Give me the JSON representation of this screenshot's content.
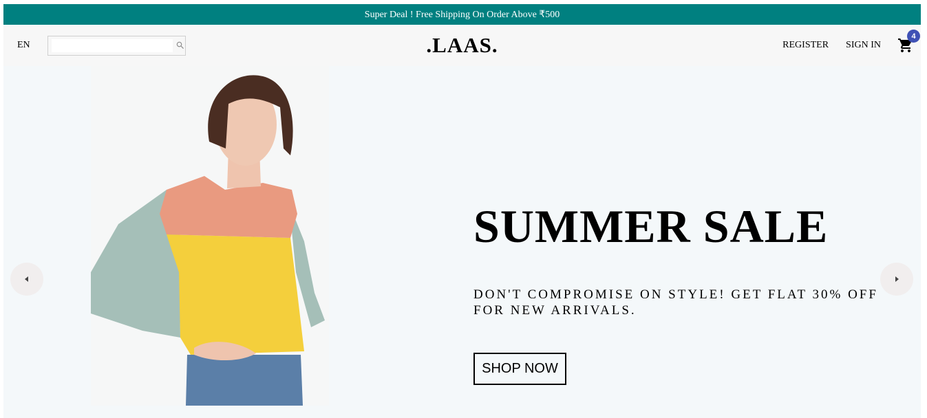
{
  "announcement": {
    "text": "Super Deal ! Free Shipping On Order Above ₹500",
    "bg_color": "#008080"
  },
  "navbar": {
    "language": "EN",
    "search": {
      "value": "",
      "placeholder": ""
    },
    "logo": ".LAAS.",
    "register_label": "REGISTER",
    "sign_in_label": "SIGN IN",
    "cart": {
      "count": "4",
      "badge_color": "#3f51b5"
    }
  },
  "slider": {
    "title": "SUMMER SALE",
    "description": "DON'T COMPROMISE ON STYLE! GET FLAT 30% OFF FOR NEW ARRIVALS.",
    "button_label": "SHOP NOW",
    "bg_color": "#f4f8fa"
  },
  "icons": {
    "search": "search-icon",
    "cart": "shopping-cart-icon",
    "left_arrow": "arrow-left-icon",
    "right_arrow": "arrow-right-icon"
  }
}
